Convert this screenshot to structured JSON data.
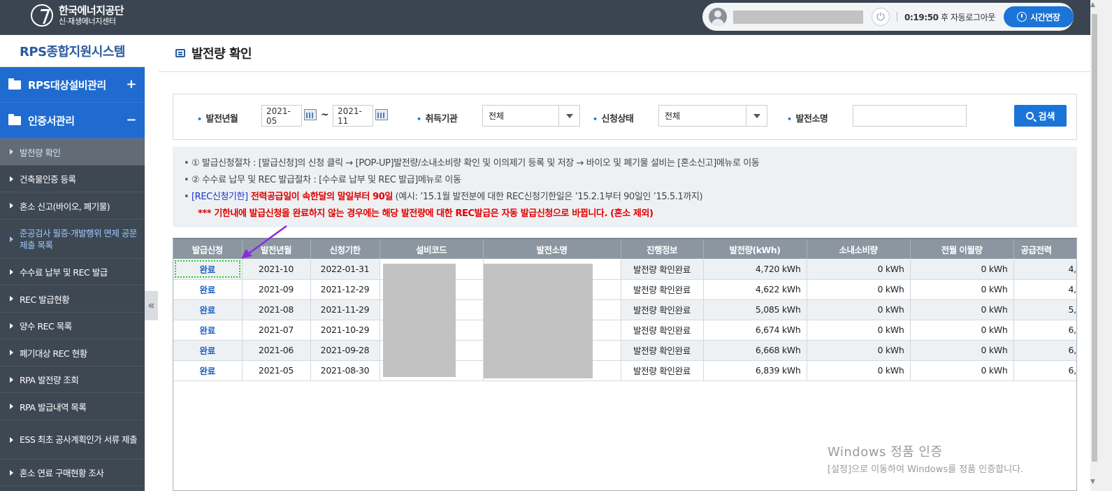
{
  "header": {
    "org_name": "한국에너지공단",
    "org_sub": "신·재생에너지센터",
    "logout_timer": "0:19:50",
    "logout_suffix": "후 자동로그아웃",
    "extend_label": "시간연장"
  },
  "sidebar": {
    "system_title": "RPS종합지원시스템",
    "groups": [
      {
        "label": "RPS대상설비관리",
        "toggle": "+"
      },
      {
        "label": "인증서관리",
        "toggle": "−"
      }
    ],
    "items": [
      {
        "label": "발전량 확인"
      },
      {
        "label": "건축물인증 등록"
      },
      {
        "label": "혼소 신고(바이오, 폐기물)"
      },
      {
        "label": "준공검사 필증·개발행위 면제 공문 제출 목록"
      },
      {
        "label": "수수료 납부 및 REC 발급"
      },
      {
        "label": "REC 발급현황"
      },
      {
        "label": "양수 REC 목록"
      },
      {
        "label": "폐기대상 REC 현황"
      },
      {
        "label": "RPA 발전량 조회"
      },
      {
        "label": "RPA 발급내역 목록"
      },
      {
        "label": "ESS 최초 공사계획인가 서류 제출"
      },
      {
        "label": "혼소 연료 구매현황 조사"
      }
    ],
    "collapse_glyph": "«"
  },
  "page": {
    "title": "발전량 확인"
  },
  "search": {
    "period_label": "발전년월",
    "from": "2021-05",
    "tilde": "~",
    "to": "2021-11",
    "agency_label": "취득기관",
    "agency_value": "전체",
    "status_label": "신청상태",
    "status_value": "전체",
    "plant_label": "발전소명",
    "plant_value": "",
    "search_label": "검색"
  },
  "notice": {
    "line1": "① 발급신청절차 : [발급신청]의 신청 클릭 → [POP-UP]발전량/소내소비량 확인 및 이의제기 등록 및 저장 → 바이오 및 폐기물 설비는 [혼소신고]메뉴로 이동",
    "line2": "② 수수료 납무 및 REC 발급절차 : [수수료 납부 및 REC 발급]메뉴로 이동",
    "line3_blue": "[REC신청기한]",
    "line3_red": " 전력공급일이 속한달의 말일부터 90일",
    "line3_rest": " (예시: ’15.1월 발전분에 대한 REC신청기한일은 ’15.2.1부터 90일인 ’15.5.1까지)",
    "line4": "*** 기한내에 발급신청을 완료하지 않는 경우에는 해당 발전량에 대한 REC발급은 자동 발급신청으로 바뀝니다. (혼소 제외)"
  },
  "table": {
    "headers": [
      "발급신청",
      "발전년월",
      "신청기한",
      "설비코드",
      "발전소명",
      "진행정보",
      "발전량(kWh)",
      "소내소비량",
      "전월 이월량",
      "공급전력"
    ],
    "rows": [
      {
        "apply": "완료",
        "ym": "2021-10",
        "deadline": "2022-01-31",
        "status": "발전량 확인완료",
        "gen": "4,720 kWh",
        "self": "0 kWh",
        "carry": "0 kWh",
        "supply": "4,"
      },
      {
        "apply": "완료",
        "ym": "2021-09",
        "deadline": "2021-12-29",
        "status": "발전량 확인완료",
        "gen": "4,622 kWh",
        "self": "0 kWh",
        "carry": "0 kWh",
        "supply": "4,"
      },
      {
        "apply": "완료",
        "ym": "2021-08",
        "deadline": "2021-11-29",
        "status": "발전량 확인완료",
        "gen": "5,085 kWh",
        "self": "0 kWh",
        "carry": "0 kWh",
        "supply": "5,"
      },
      {
        "apply": "완료",
        "ym": "2021-07",
        "deadline": "2021-10-29",
        "status": "발전량 확인완료",
        "gen": "6,674 kWh",
        "self": "0 kWh",
        "carry": "0 kWh",
        "supply": "6,"
      },
      {
        "apply": "완료",
        "ym": "2021-06",
        "deadline": "2021-09-28",
        "status": "발전량 확인완료",
        "gen": "6,668 kWh",
        "self": "0 kWh",
        "carry": "0 kWh",
        "supply": "6,"
      },
      {
        "apply": "완료",
        "ym": "2021-05",
        "deadline": "2021-08-30",
        "status": "발전량 확인완료",
        "gen": "6,839 kWh",
        "self": "0 kWh",
        "carry": "0 kWh",
        "supply": "6,"
      }
    ]
  },
  "watermark": {
    "line1": "Windows 정품 인증",
    "line2": "[설정]으로 이동하여 Windows를 정품 인증합니다."
  },
  "colors": {
    "topbar": "#3a4551",
    "sidebar": "#3e4853",
    "accent": "#1b74d8",
    "annotation_arrow": "#8a2be2",
    "focus_outline": "#2ecc2e"
  }
}
